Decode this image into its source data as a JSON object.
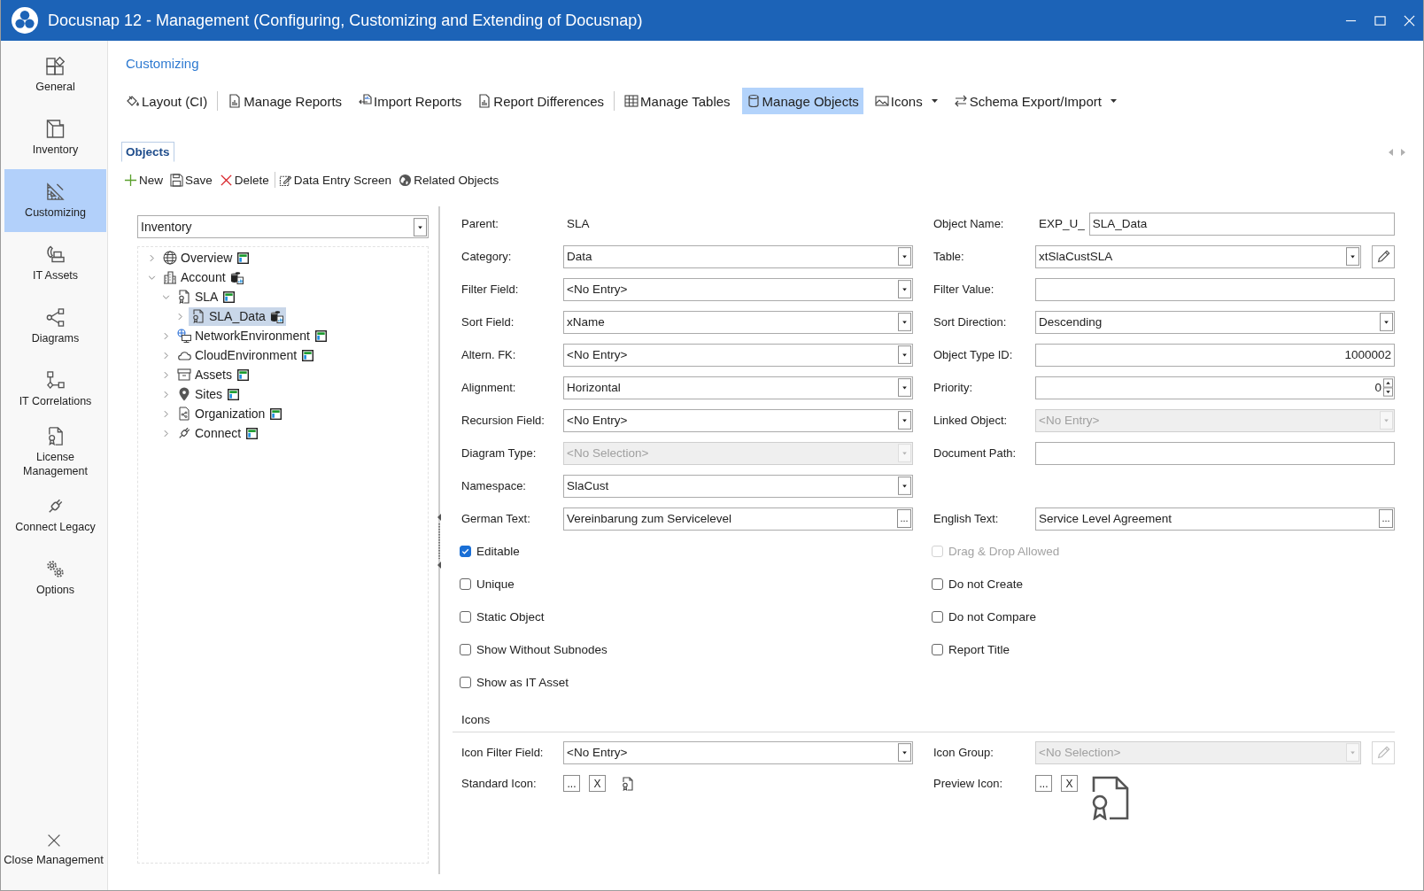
{
  "window": {
    "title": "Docusnap 12 - Management (Configuring, Customizing and Extending of Docusnap)"
  },
  "sidebar": {
    "items": [
      {
        "label": "General",
        "selected": false
      },
      {
        "label": "Inventory",
        "selected": false
      },
      {
        "label": "Customizing",
        "selected": true
      },
      {
        "label": "IT Assets",
        "selected": false
      },
      {
        "label": "Diagrams",
        "selected": false
      },
      {
        "label": "IT Correlations",
        "selected": false
      },
      {
        "label": "License Management",
        "selected": false
      },
      {
        "label": "Connect Legacy",
        "selected": false
      },
      {
        "label": "Options",
        "selected": false
      }
    ],
    "close": {
      "label": "Close Management"
    }
  },
  "section": {
    "title": "Customizing"
  },
  "toolbar": {
    "groups": [
      {
        "items": [
          {
            "label": "Layout (CI)",
            "selected": false,
            "dropdown": false
          }
        ]
      },
      {
        "items": [
          {
            "label": "Manage Reports",
            "selected": false,
            "dropdown": false
          },
          {
            "label": "Import Reports",
            "selected": false,
            "dropdown": false
          },
          {
            "label": "Report Differences",
            "selected": false,
            "dropdown": false
          }
        ]
      },
      {
        "items": [
          {
            "label": "Manage Tables",
            "selected": false,
            "dropdown": false
          },
          {
            "label": "Manage Objects",
            "selected": true,
            "dropdown": false
          },
          {
            "label": "Icons",
            "selected": false,
            "dropdown": true
          },
          {
            "label": "Schema Export/Import",
            "selected": false,
            "dropdown": true
          }
        ]
      }
    ]
  },
  "tabs": [
    {
      "label": "Objects",
      "selected": true
    }
  ],
  "object_toolbar": {
    "groups": [
      {
        "items": [
          {
            "label": "New"
          },
          {
            "label": "Save"
          },
          {
            "label": "Delete"
          }
        ]
      },
      {
        "items": [
          {
            "label": "Data Entry Screen"
          },
          {
            "label": "Related Objects"
          }
        ]
      }
    ]
  },
  "object_tree": {
    "filter": {
      "value": "Inventory"
    },
    "nodes": [
      {
        "label": "Overview",
        "kind": "form",
        "expanded": false,
        "selected": false
      },
      {
        "label": "Account",
        "kind": "data",
        "expanded": true,
        "selected": false,
        "children": [
          {
            "label": "SLA",
            "kind": "form",
            "expanded": true,
            "selected": false,
            "children": [
              {
                "label": "SLA_Data",
                "kind": "data",
                "expanded": false,
                "selected": true
              }
            ]
          },
          {
            "label": "NetworkEnvironment",
            "kind": "form",
            "expanded": false,
            "selected": false
          },
          {
            "label": "CloudEnvironment",
            "kind": "form",
            "expanded": false,
            "selected": false
          },
          {
            "label": "Assets",
            "kind": "form",
            "expanded": false,
            "selected": false
          },
          {
            "label": "Sites",
            "kind": "form",
            "expanded": false,
            "selected": false
          },
          {
            "label": "Organization",
            "kind": "form",
            "expanded": false,
            "selected": false
          },
          {
            "label": "Connect",
            "kind": "form",
            "expanded": false,
            "selected": false
          }
        ]
      }
    ]
  },
  "form": {
    "rows": [
      {
        "left": {
          "kind": "readonly",
          "label": "Parent:",
          "value": "SLA",
          "disabled": false
        },
        "right": {
          "kind": "prefixed",
          "label": "Object Name:",
          "prefix": "EXP_U_",
          "value": "SLA_Data",
          "disabled": false
        }
      },
      {
        "left": {
          "kind": "combo",
          "label": "Category:",
          "value": "Data",
          "disabled": false
        },
        "right": {
          "kind": "combo_edit",
          "label": "Table:",
          "value": "xtSlaCustSLA",
          "disabled": false
        }
      },
      {
        "left": {
          "kind": "combo",
          "label": "Filter Field:",
          "value": "<No Entry>",
          "disabled": false
        },
        "right": {
          "kind": "input",
          "label": "Filter Value:",
          "disabled": false
        }
      },
      {
        "left": {
          "kind": "combo",
          "label": "Sort Field:",
          "value": "xName",
          "disabled": false
        },
        "right": {
          "kind": "combo",
          "label": "Sort Direction:",
          "value": "Descending",
          "disabled": false
        }
      },
      {
        "left": {
          "kind": "combo",
          "label": "Altern. FK:",
          "value": "<No Entry>",
          "disabled": false
        },
        "right": {
          "kind": "number",
          "label": "Object Type ID:",
          "value": "1000002",
          "disabled": false
        }
      },
      {
        "left": {
          "kind": "combo",
          "label": "Alignment:",
          "value": "Horizontal",
          "disabled": false
        },
        "right": {
          "kind": "spinner",
          "label": "Priority:",
          "value": "0",
          "disabled": false
        }
      },
      {
        "left": {
          "kind": "combo",
          "label": "Recursion Field:",
          "value": "<No Entry>",
          "disabled": false
        },
        "right": {
          "kind": "combo",
          "label": "Linked Object:",
          "value": "<No Entry>",
          "disabled": true
        }
      },
      {
        "left": {
          "kind": "combo",
          "label": "Diagram Type:",
          "value": "<No Selection>",
          "disabled": true
        },
        "right": {
          "kind": "input",
          "label": "Document Path:",
          "disabled": false
        }
      },
      {
        "left": {
          "kind": "combo",
          "label": "Namespace:",
          "value": "SlaCust",
          "disabled": false
        }
      },
      {
        "left": {
          "kind": "text_button",
          "label": "German Text:",
          "value": "Vereinbarung zum Servicelevel",
          "button": "...",
          "disabled": false
        },
        "right": {
          "kind": "text_button",
          "label": "English Text:",
          "value": "Service Level Agreement",
          "button": "...",
          "disabled": false
        }
      },
      {
        "left": {
          "kind": "checkbox",
          "label": "Editable",
          "checked": true,
          "disabled": false
        },
        "right": {
          "kind": "checkbox",
          "label": "Drag & Drop Allowed",
          "checked": false,
          "disabled": true
        }
      },
      {
        "left": {
          "kind": "checkbox",
          "label": "Unique",
          "checked": false,
          "disabled": false
        },
        "right": {
          "kind": "checkbox",
          "label": "Do not Create",
          "checked": false,
          "disabled": false
        }
      },
      {
        "left": {
          "kind": "checkbox",
          "label": "Static Object",
          "checked": false,
          "disabled": false
        },
        "right": {
          "kind": "checkbox",
          "label": "Do not Compare",
          "checked": false,
          "disabled": false
        }
      },
      {
        "left": {
          "kind": "checkbox",
          "label": "Show Without Subnodes",
          "checked": false,
          "disabled": false
        },
        "right": {
          "kind": "checkbox",
          "label": "Report Title",
          "checked": false,
          "disabled": false
        }
      },
      {
        "left": {
          "kind": "checkbox",
          "label": "Show as IT Asset",
          "checked": false,
          "disabled": false
        }
      }
    ]
  },
  "icon_settings": {
    "title": "Icons",
    "rows": [
      {
        "left": {
          "kind": "combo",
          "label": "Icon Filter Field:",
          "value": "<No Entry>",
          "disabled": false
        },
        "right": {
          "kind": "combo_edit",
          "label": "Icon Group:",
          "value": "<No Selection>",
          "disabled": true
        }
      },
      {
        "left": {
          "kind": "icon_small",
          "label": "Standard Icon:",
          "buttons": [
            "...",
            "X"
          ],
          "disabled": false
        },
        "right": {
          "kind": "icon_large",
          "label": "Preview Icon:",
          "buttons": [
            "...",
            "X"
          ],
          "disabled": false
        }
      }
    ]
  }
}
